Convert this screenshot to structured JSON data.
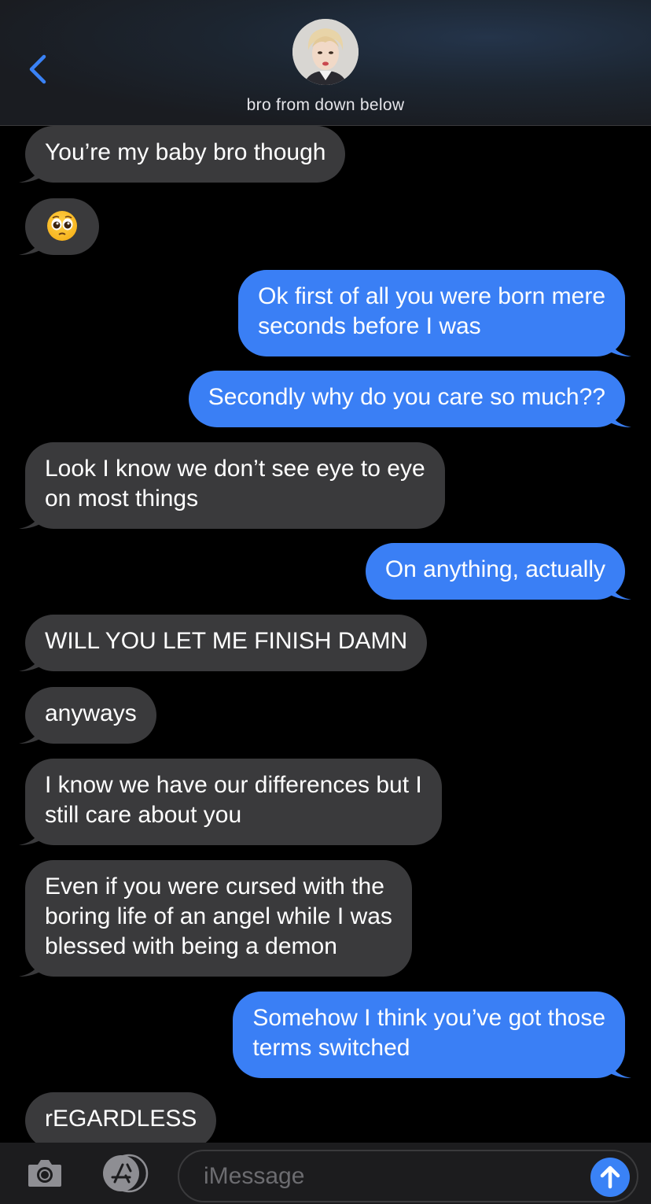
{
  "header": {
    "contact_name": "bro from down below"
  },
  "messages": [
    {
      "side": "in",
      "text": "You’re my baby bro though"
    },
    {
      "side": "in",
      "text": "",
      "emoji": "pleading-face"
    },
    {
      "side": "out",
      "lines": [
        "Ok first of all you were born mere",
        "seconds before I was"
      ]
    },
    {
      "side": "out",
      "text": "Secondly why do you care so much??"
    },
    {
      "side": "in",
      "lines": [
        "Look I know we don’t see eye to eye",
        "on most things"
      ]
    },
    {
      "side": "out",
      "text": "On anything, actually"
    },
    {
      "side": "in",
      "text": "WILL YOU LET ME FINISH DAMN"
    },
    {
      "side": "in",
      "text": "anyways"
    },
    {
      "side": "in",
      "lines": [
        "I know we have our differences but I",
        "still care about you"
      ]
    },
    {
      "side": "in",
      "lines": [
        "Even if you were cursed with the",
        "boring life of an angel while I was",
        "blessed with being a demon"
      ]
    },
    {
      "side": "out",
      "lines": [
        "Somehow I think you’ve got those",
        "terms switched"
      ]
    },
    {
      "side": "in",
      "text": "rEGARDLESS"
    }
  ],
  "composer": {
    "placeholder": "iMessage",
    "camera_icon": "camera-icon",
    "apps_icon": "app-store-icon",
    "send_icon": "send-arrow-icon"
  },
  "colors": {
    "incoming_bubble": "#3a3a3c",
    "outgoing_bubble": "#3a7ff5",
    "accent": "#3a82f6"
  }
}
